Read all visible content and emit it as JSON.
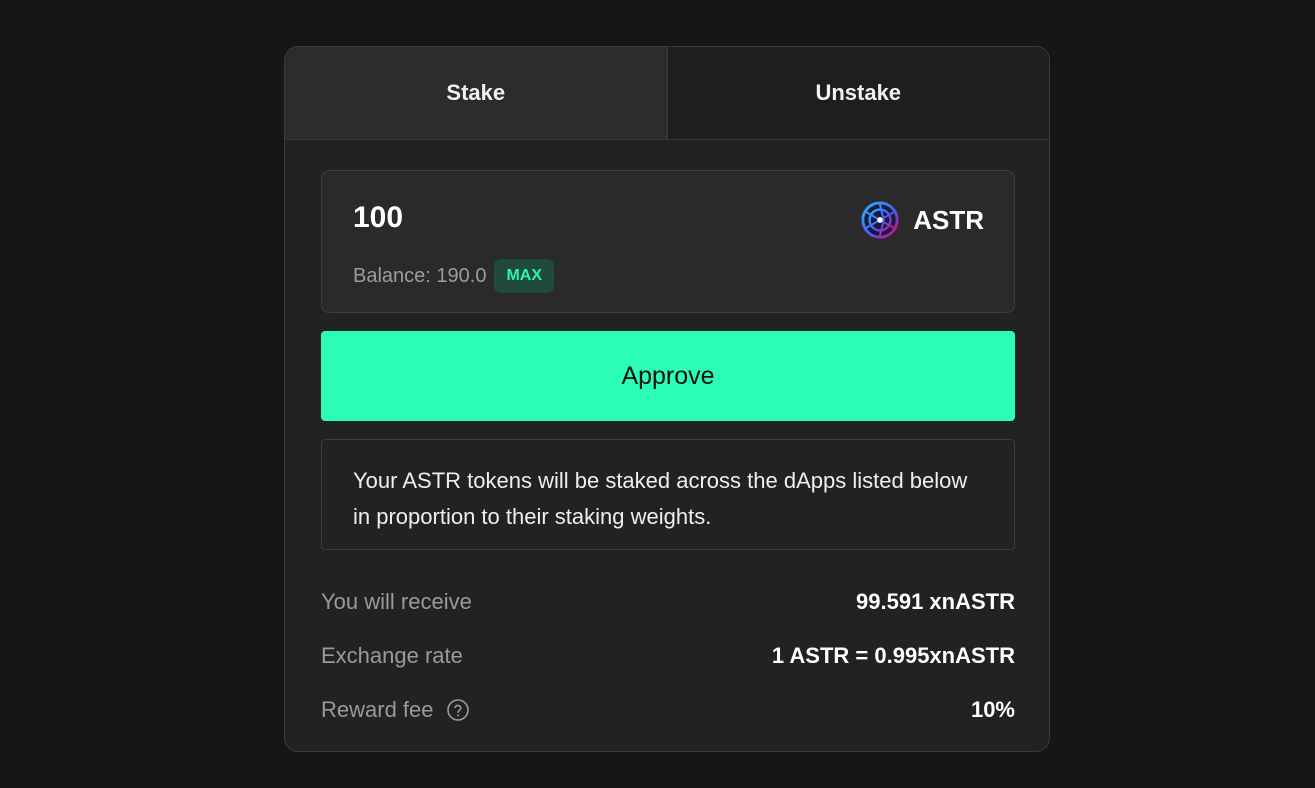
{
  "tabs": [
    {
      "label": "Stake",
      "active": true
    },
    {
      "label": "Unstake",
      "active": false
    }
  ],
  "input": {
    "amount": "100",
    "token_symbol": "ASTR",
    "token_icon": "astar-logo-icon",
    "balance_text": "Balance: 190.0",
    "max_label": "MAX"
  },
  "approve_label": "Approve",
  "notice_text": "Your ASTR tokens will be staked across the dApps listed below in proportion to their staking weights.",
  "details": {
    "receive_label": "You will receive",
    "receive_value": "99.591 xnASTR",
    "rate_label": "Exchange rate",
    "rate_value": "1 ASTR = 0.995xnASTR",
    "fee_label": "Reward fee",
    "fee_value": "10%"
  },
  "colors": {
    "accent": "#2cfdb4",
    "max_bg": "#1f4a3c",
    "max_text": "#2cf2b0",
    "card_bg": "#222222",
    "page_bg": "#161616"
  }
}
